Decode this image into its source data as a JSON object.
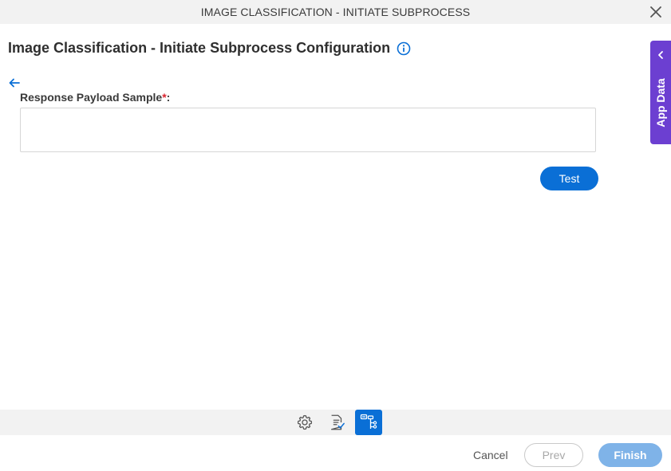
{
  "window": {
    "title": "IMAGE CLASSIFICATION - INITIATE SUBPROCESS",
    "close_icon": "close-icon"
  },
  "page": {
    "title": "Image Classification - Initiate Subprocess Configuration",
    "info_icon": "info-icon"
  },
  "form": {
    "response_payload_label": "Response Payload Sample",
    "required_marker": "*",
    "label_suffix": ":",
    "response_payload_value": "",
    "test_label": "Test"
  },
  "side_panel": {
    "label": "App Data"
  },
  "steps": [
    {
      "icon": "gear-icon",
      "active": false
    },
    {
      "icon": "document-check-icon",
      "active": false
    },
    {
      "icon": "subprocess-icon",
      "active": true
    }
  ],
  "footer": {
    "cancel_label": "Cancel",
    "prev_label": "Prev",
    "finish_label": "Finish"
  },
  "colors": {
    "primary": "#0a6fd6",
    "app_data_tab": "#6c3fd1",
    "required": "#d9232e",
    "finish_disabled": "#7fb3e8"
  }
}
